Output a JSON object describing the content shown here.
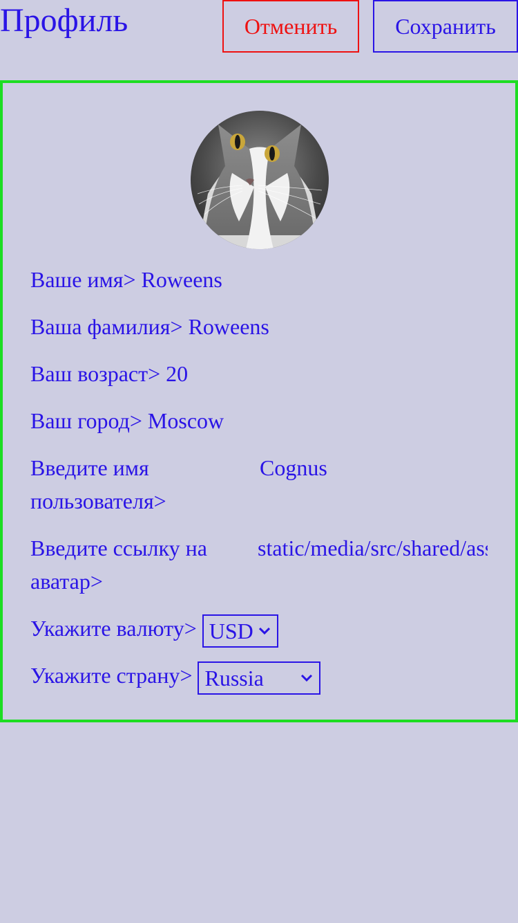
{
  "header": {
    "title": "Профиль",
    "cancel_label": "Отменить",
    "save_label": "Сохранить"
  },
  "profile": {
    "first_name_label": "Ваше имя>",
    "first_name_value": "Roweens",
    "last_name_label": "Ваша фамилия>",
    "last_name_value": "Roweens",
    "age_label": "Ваш возраст>",
    "age_value": "20",
    "city_label": "Ваш город>",
    "city_value": "Moscow",
    "username_label": "Введите имя пользователя>",
    "username_value": "Cognus",
    "avatar_link_label": "Введите ссылку на аватар>",
    "avatar_link_value": "static/media/src/shared/assets",
    "currency_label": "Укажите валюту>",
    "currency_value": "USD",
    "country_label": "Укажите страну>",
    "country_value": "Russia"
  },
  "icons": {
    "avatar": "cat-photo",
    "select_chevron": "chevron-down-icon"
  },
  "colors": {
    "background": "#cdcde2",
    "text": "#2a14e6",
    "cancel": "#ee1111",
    "card_border": "#1ddd22"
  }
}
